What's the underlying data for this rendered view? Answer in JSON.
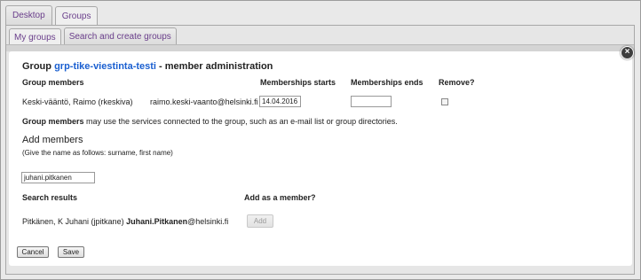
{
  "top_tabs": [
    "Desktop",
    "Groups"
  ],
  "sub_tabs": [
    "My groups",
    "Search and create groups"
  ],
  "dialog": {
    "title_prefix": "Group",
    "group_name": "grp-tike-viestinta-testi",
    "title_suffix": "- member administration",
    "close_glyph": "×",
    "columns": {
      "members": "Group members",
      "starts": "Memberships starts",
      "ends": "Memberships ends",
      "remove": "Remove?"
    },
    "member": {
      "name": "Keski-vääntö, Raimo (rkeskiva)",
      "email": "raimo.keski-vaanto@helsinki.fi",
      "start": "14.04.2016",
      "end": ""
    },
    "info_bold": "Group members",
    "info_text": " may use the services connected to the group, such as an e-mail list or group directories.",
    "add_members": {
      "title": "Add members",
      "hint": "(Give the name as follows: surname, first name)",
      "search_value": "juhani.pitkanen"
    },
    "results": {
      "header": "Search results",
      "add_header": "Add as a member?",
      "person": "Pitkänen, K Juhani (jpitkane)",
      "email": "Juhani.Pitkanen",
      "email_domain": "@helsinki.fi",
      "add_button": "Add"
    },
    "buttons": {
      "cancel": "Cancel",
      "save": "Save"
    }
  }
}
